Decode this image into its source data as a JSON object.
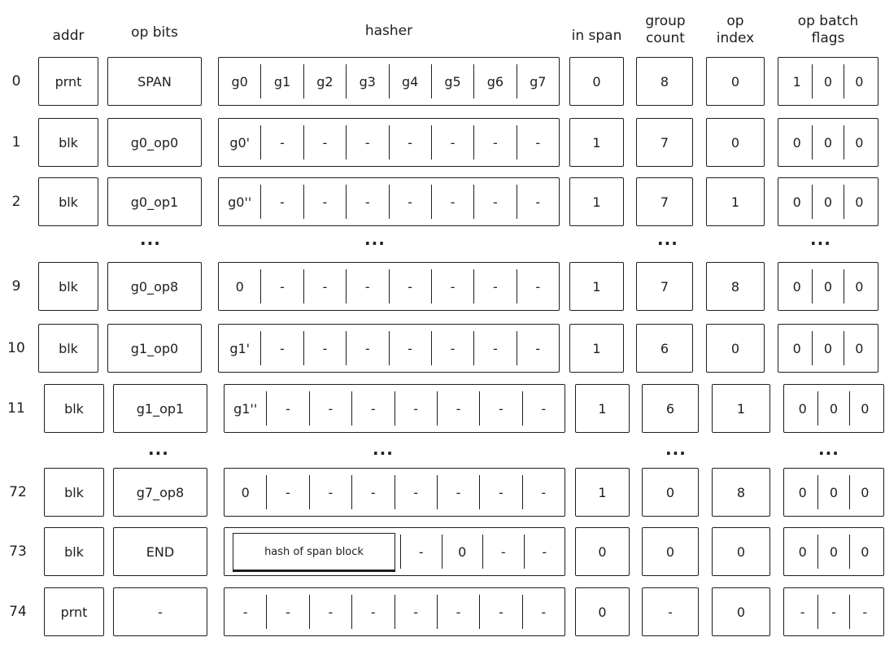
{
  "headers": {
    "addr": "addr",
    "op_bits": "op bits",
    "hasher": "hasher",
    "in_span": "in span",
    "group_count": "group\ncount",
    "op_index": "op\nindex",
    "flags": "op batch\nflags"
  },
  "ellipsis": "...",
  "rows": [
    {
      "label": "0",
      "addr": "prnt",
      "op_bits": "SPAN",
      "hasher": [
        "g0",
        "g1",
        "g2",
        "g3",
        "g4",
        "g5",
        "g6",
        "g7"
      ],
      "in_span": "0",
      "group_count": "8",
      "op_index": "0",
      "flags": [
        "1",
        "0",
        "0"
      ]
    },
    {
      "label": "1",
      "addr": "blk",
      "op_bits": "g0_op0",
      "hasher": [
        "g0'",
        "-",
        "-",
        "-",
        "-",
        "-",
        "-",
        "-"
      ],
      "in_span": "1",
      "group_count": "7",
      "op_index": "0",
      "flags": [
        "0",
        "0",
        "0"
      ]
    },
    {
      "label": "2",
      "addr": "blk",
      "op_bits": "g0_op1",
      "hasher": [
        "g0''",
        "-",
        "-",
        "-",
        "-",
        "-",
        "-",
        "-"
      ],
      "in_span": "1",
      "group_count": "7",
      "op_index": "1",
      "flags": [
        "0",
        "0",
        "0"
      ],
      "gap_after": true
    },
    {
      "label": "9",
      "addr": "blk",
      "op_bits": "g0_op8",
      "hasher": [
        "0",
        "-",
        "-",
        "-",
        "-",
        "-",
        "-",
        "-"
      ],
      "in_span": "1",
      "group_count": "7",
      "op_index": "8",
      "flags": [
        "0",
        "0",
        "0"
      ]
    },
    {
      "label": "10",
      "addr": "blk",
      "op_bits": "g1_op0",
      "hasher": [
        "g1'",
        "-",
        "-",
        "-",
        "-",
        "-",
        "-",
        "-"
      ],
      "in_span": "1",
      "group_count": "6",
      "op_index": "0",
      "flags": [
        "0",
        "0",
        "0"
      ]
    },
    {
      "label": "11",
      "addr": "blk",
      "op_bits": "g1_op1",
      "hasher": [
        "g1''",
        "-",
        "-",
        "-",
        "-",
        "-",
        "-",
        "-"
      ],
      "in_span": "1",
      "group_count": "6",
      "op_index": "1",
      "flags": [
        "0",
        "0",
        "0"
      ],
      "gap_after": true
    },
    {
      "label": "72",
      "addr": "blk",
      "op_bits": "g7_op8",
      "hasher": [
        "0",
        "-",
        "-",
        "-",
        "-",
        "-",
        "-",
        "-"
      ],
      "in_span": "1",
      "group_count": "0",
      "op_index": "8",
      "flags": [
        "0",
        "0",
        "0"
      ]
    },
    {
      "label": "73",
      "addr": "blk",
      "op_bits": "END",
      "hash_block": "hash of span block",
      "hasher": [
        "-",
        "0",
        "-",
        "-"
      ],
      "in_span": "0",
      "group_count": "0",
      "op_index": "0",
      "flags": [
        "0",
        "0",
        "0"
      ]
    },
    {
      "label": "74",
      "addr": "prnt",
      "op_bits": "-",
      "hasher": [
        "-",
        "-",
        "-",
        "-",
        "-",
        "-",
        "-",
        "-"
      ],
      "in_span": "0",
      "group_count": "-",
      "op_index": "0",
      "flags": [
        "-",
        "-",
        "-"
      ]
    }
  ]
}
